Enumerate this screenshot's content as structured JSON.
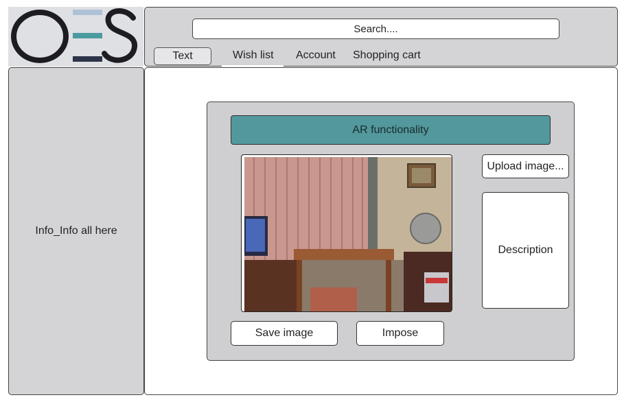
{
  "logo": {
    "text": "OES",
    "colors": {
      "dark": "#1c1c22",
      "accent": "#4a9aa0",
      "light": "#aec2d6",
      "navy": "#2c3448"
    }
  },
  "search": {
    "placeholder": "Search...."
  },
  "nav": {
    "tabs": [
      {
        "label": "Text",
        "active": true
      },
      {
        "label": "Wish list"
      },
      {
        "label": "Account"
      },
      {
        "label": "Shopping cart"
      }
    ]
  },
  "sidebar": {
    "text": "Info_Info all here"
  },
  "ar": {
    "title": "AR functionality",
    "upload_label": "Upload image...",
    "description_label": "Description",
    "save_label": "Save image",
    "impose_label": "Impose",
    "image_desc": "living room photo",
    "title_bar_color": "#52989c"
  }
}
